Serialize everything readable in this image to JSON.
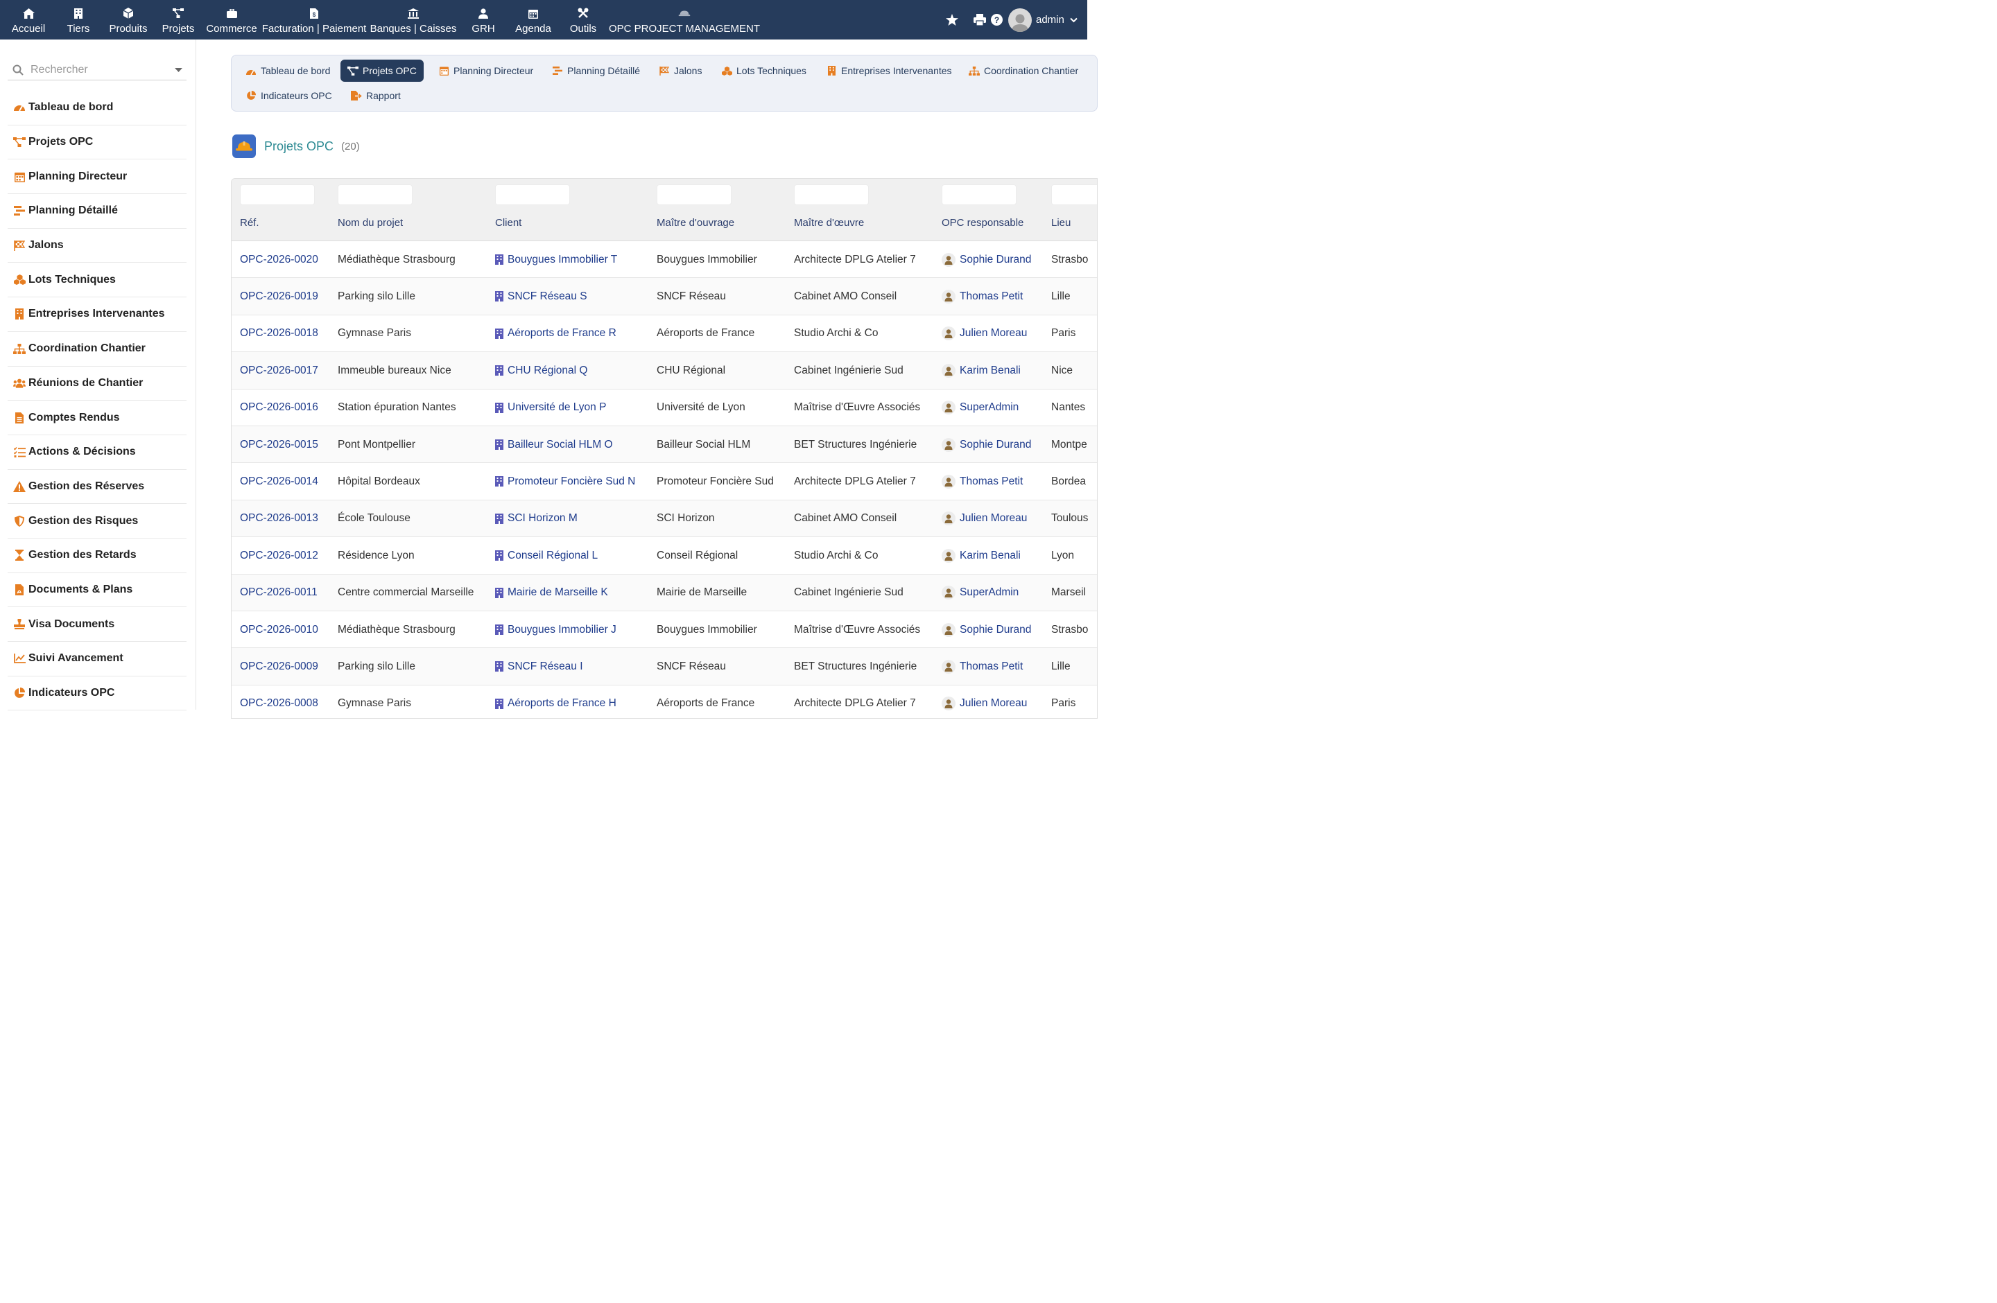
{
  "topnav": {
    "items": [
      {
        "label": "Accueil",
        "icon": "home-icon"
      },
      {
        "label": "Tiers",
        "icon": "building-icon"
      },
      {
        "label": "Produits",
        "icon": "cube-icon"
      },
      {
        "label": "Projets",
        "icon": "sitemap-icon"
      },
      {
        "label": "Commerce",
        "icon": "briefcase-icon"
      },
      {
        "label": "Facturation | Paiement",
        "icon": "invoice-icon"
      },
      {
        "label": "Banques | Caisses",
        "icon": "bank-icon"
      },
      {
        "label": "GRH",
        "icon": "user-tie-icon"
      },
      {
        "label": "Agenda",
        "icon": "calendar-icon"
      },
      {
        "label": "Outils",
        "icon": "tools-icon"
      },
      {
        "label": "OPC PROJECT MANAGEMENT",
        "icon": "hardhat-icon"
      }
    ],
    "user": "admin"
  },
  "search": {
    "placeholder": "Rechercher"
  },
  "sidebar": {
    "items": [
      {
        "label": "Tableau de bord",
        "icon": "dashboard-icon"
      },
      {
        "label": "Projets OPC",
        "icon": "project-diagram-icon"
      },
      {
        "label": "Planning Directeur",
        "icon": "calendar-icon"
      },
      {
        "label": "Planning Détaillé",
        "icon": "gantt-icon"
      },
      {
        "label": "Jalons",
        "icon": "flag-checkered-icon"
      },
      {
        "label": "Lots Techniques",
        "icon": "cubes-icon"
      },
      {
        "label": "Entreprises Intervenantes",
        "icon": "building-icon"
      },
      {
        "label": "Coordination Chantier",
        "icon": "sitemap-icon"
      },
      {
        "label": "Réunions de Chantier",
        "icon": "users-icon"
      },
      {
        "label": "Comptes Rendus",
        "icon": "file-alt-icon"
      },
      {
        "label": "Actions & Décisions",
        "icon": "tasks-icon"
      },
      {
        "label": "Gestion des Réserves",
        "icon": "warning-icon"
      },
      {
        "label": "Gestion des Risques",
        "icon": "shield-icon"
      },
      {
        "label": "Gestion des Retards",
        "icon": "hourglass-icon"
      },
      {
        "label": "Documents & Plans",
        "icon": "file-pdf-icon"
      },
      {
        "label": "Visa Documents",
        "icon": "stamp-icon"
      },
      {
        "label": "Suivi Avancement",
        "icon": "chart-line-icon"
      },
      {
        "label": "Indicateurs OPC",
        "icon": "chart-pie-icon"
      }
    ]
  },
  "subtabs": [
    {
      "label": "Tableau de bord",
      "icon": "dashboard-icon"
    },
    {
      "label": "Projets OPC",
      "icon": "project-diagram-icon"
    },
    {
      "label": "Planning Directeur",
      "icon": "calendar-icon"
    },
    {
      "label": "Planning Détaillé",
      "icon": "gantt-icon"
    },
    {
      "label": "Jalons",
      "icon": "flag-checkered-icon"
    },
    {
      "label": "Lots Techniques",
      "icon": "cubes-icon"
    },
    {
      "label": "Entreprises Intervenantes",
      "icon": "building-icon"
    },
    {
      "label": "Coordination Chantier",
      "icon": "sitemap-icon"
    },
    {
      "label": "Indicateurs OPC",
      "icon": "chart-pie-icon"
    },
    {
      "label": "Rapport",
      "icon": "file-export-icon"
    }
  ],
  "page": {
    "title": "Projets OPC",
    "count": "(20)"
  },
  "table": {
    "headers": [
      "Réf.",
      "Nom du projet",
      "Client",
      "Maître d'ouvrage",
      "Maître d'œuvre",
      "OPC responsable",
      "Lieu"
    ],
    "rows": [
      [
        "OPC-2026-0020",
        "Médiathèque Strasbourg",
        "Bouygues Immobilier T",
        "Bouygues Immobilier",
        "Architecte DPLG Atelier 7",
        "Sophie Durand",
        "Strasbo"
      ],
      [
        "OPC-2026-0019",
        "Parking silo Lille",
        "SNCF Réseau S",
        "SNCF Réseau",
        "Cabinet AMO Conseil",
        "Thomas Petit",
        "Lille"
      ],
      [
        "OPC-2026-0018",
        "Gymnase Paris",
        "Aéroports de France R",
        "Aéroports de France",
        "Studio Archi & Co",
        "Julien Moreau",
        "Paris"
      ],
      [
        "OPC-2026-0017",
        "Immeuble bureaux Nice",
        "CHU Régional Q",
        "CHU Régional",
        "Cabinet Ingénierie Sud",
        "Karim Benali",
        "Nice"
      ],
      [
        "OPC-2026-0016",
        "Station épuration Nantes",
        "Université de Lyon P",
        "Université de Lyon",
        "Maîtrise d'Œuvre Associés",
        "SuperAdmin",
        "Nantes"
      ],
      [
        "OPC-2026-0015",
        "Pont Montpellier",
        "Bailleur Social HLM O",
        "Bailleur Social HLM",
        "BET Structures Ingénierie",
        "Sophie Durand",
        "Montpe"
      ],
      [
        "OPC-2026-0014",
        "Hôpital Bordeaux",
        "Promoteur Foncière Sud N",
        "Promoteur Foncière Sud",
        "Architecte DPLG Atelier 7",
        "Thomas Petit",
        "Bordea"
      ],
      [
        "OPC-2026-0013",
        "École Toulouse",
        "SCI Horizon M",
        "SCI Horizon",
        "Cabinet AMO Conseil",
        "Julien Moreau",
        "Toulous"
      ],
      [
        "OPC-2026-0012",
        "Résidence Lyon",
        "Conseil Régional L",
        "Conseil Régional",
        "Studio Archi & Co",
        "Karim Benali",
        "Lyon"
      ],
      [
        "OPC-2026-0011",
        "Centre commercial Marseille",
        "Mairie de Marseille K",
        "Mairie de Marseille",
        "Cabinet Ingénierie Sud",
        "SuperAdmin",
        "Marseil"
      ],
      [
        "OPC-2026-0010",
        "Médiathèque Strasbourg",
        "Bouygues Immobilier J",
        "Bouygues Immobilier",
        "Maîtrise d'Œuvre Associés",
        "Sophie Durand",
        "Strasbo"
      ],
      [
        "OPC-2026-0009",
        "Parking silo Lille",
        "SNCF Réseau I",
        "SNCF Réseau",
        "BET Structures Ingénierie",
        "Thomas Petit",
        "Lille"
      ],
      [
        "OPC-2026-0008",
        "Gymnase Paris",
        "Aéroports de France H",
        "Aéroports de France",
        "Architecte DPLG Atelier 7",
        "Julien Moreau",
        "Paris"
      ]
    ]
  },
  "colors": {
    "topbar": "#263c5c",
    "accent": "#e67e22",
    "link": "#1f3c8c",
    "title": "#2d8a93"
  }
}
